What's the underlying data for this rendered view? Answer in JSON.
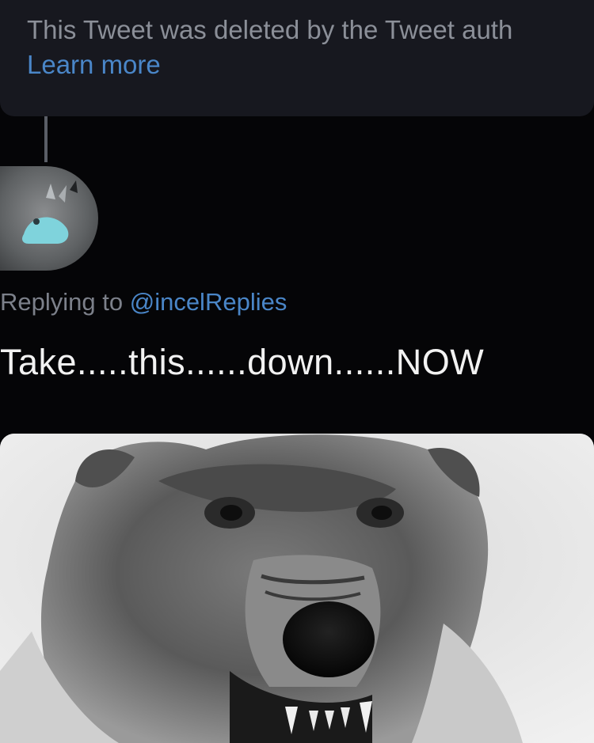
{
  "deleted_tweet": {
    "message": "This Tweet was deleted by the Tweet auth",
    "learn_more": "Learn more"
  },
  "reply": {
    "avatar_icon": "avatar-image",
    "replying_prefix": "Replying to ",
    "replying_handle": "@incelReplies",
    "text": "Take.....this......down......NOW"
  },
  "media": {
    "icon": "wolf-photo"
  },
  "colors": {
    "background": "#050507",
    "card": "#17181f",
    "link": "#4a86c8",
    "muted_text": "#8b8f98",
    "tweet_text": "#f2f2f2"
  }
}
